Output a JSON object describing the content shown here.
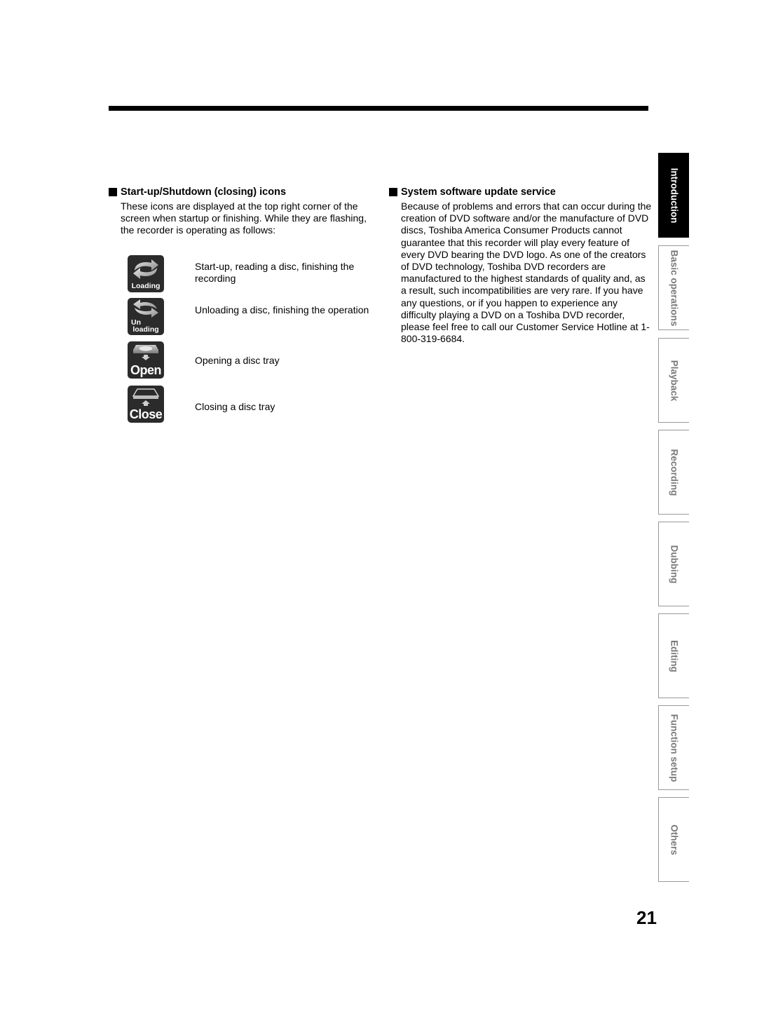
{
  "left_section": {
    "heading": "Start-up/Shutdown (closing) icons",
    "intro": "These icons are displayed at the top right corner of the screen when startup or finishing. While they are flashing, the recorder is operating as follows:",
    "icons": [
      {
        "icon": "loading-icon",
        "label": "Loading",
        "description": "Start-up, reading a disc, finishing the recording"
      },
      {
        "icon": "unloading-icon",
        "label_line1": "Un",
        "label_line2": "loading",
        "description": "Unloading a disc, finishing the operation"
      },
      {
        "icon": "open-tray-icon",
        "label": "Open",
        "description": "Opening a disc tray"
      },
      {
        "icon": "close-tray-icon",
        "label": "Close",
        "description": "Closing a disc tray"
      }
    ]
  },
  "right_section": {
    "heading": "System software update service",
    "body": "Because of problems and errors that can occur during the creation of DVD software and/or the manufacture of DVD discs, Toshiba America Consumer Products cannot guarantee that this recorder will play every feature of every DVD bearing the DVD logo. As one of the creators of DVD technology, Toshiba DVD recorders are manufactured to the highest standards of quality and, as a result, such incompatibilities are very rare. If you have any questions, or if you happen to experience any difficulty playing a DVD on a Toshiba DVD recorder, please feel free to call our Customer Service Hotline at 1-800-319-6684."
  },
  "side_tabs": [
    {
      "label": "Introduction",
      "active": true
    },
    {
      "label": "Basic operations",
      "active": false
    },
    {
      "label": "Playback",
      "active": false
    },
    {
      "label": "Recording",
      "active": false
    },
    {
      "label": "Dubbing",
      "active": false
    },
    {
      "label": "Editing",
      "active": false
    },
    {
      "label": "Function setup",
      "active": false
    },
    {
      "label": "Others",
      "active": false
    }
  ],
  "page_number": "21",
  "colors": {
    "icon_bg": "#2b2b2b",
    "tab_text": "#7a7a7a",
    "active_tab_bg": "#000000"
  }
}
